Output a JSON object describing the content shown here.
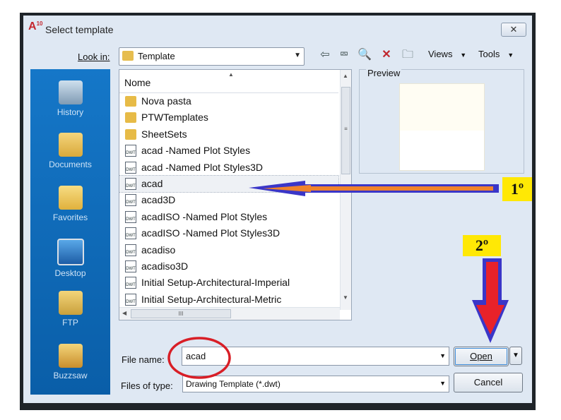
{
  "window": {
    "title": "Select template",
    "app_icon_text": "A",
    "app_icon_sub": "10",
    "close_symbol": "✕"
  },
  "toolbar": {
    "look_in_label": "Look in:",
    "look_in_value": "Template",
    "views_label": "Views",
    "tools_label": "Tools",
    "icons": [
      "back-icon",
      "up-folder-icon",
      "search-web-icon",
      "delete-icon",
      "new-folder-icon"
    ]
  },
  "places": [
    {
      "label": "History",
      "icon": "history-icon"
    },
    {
      "label": "Documents",
      "icon": "documents-icon"
    },
    {
      "label": "Favorites",
      "icon": "favorites-icon"
    },
    {
      "label": "Desktop",
      "icon": "desktop-icon"
    },
    {
      "label": "FTP",
      "icon": "ftp-icon"
    },
    {
      "label": "Buzzsaw",
      "icon": "buzzsaw-icon"
    }
  ],
  "file_list": {
    "column_header": "Nome",
    "items": [
      {
        "name": "Nova pasta",
        "type": "folder"
      },
      {
        "name": "PTWTemplates",
        "type": "folder"
      },
      {
        "name": "SheetSets",
        "type": "folder"
      },
      {
        "name": "acad -Named Plot Styles",
        "type": "dwt"
      },
      {
        "name": "acad -Named Plot Styles3D",
        "type": "dwt"
      },
      {
        "name": "acad",
        "type": "dwt",
        "selected": true
      },
      {
        "name": "acad3D",
        "type": "dwt"
      },
      {
        "name": "acadISO -Named Plot Styles",
        "type": "dwt"
      },
      {
        "name": "acadISO -Named Plot Styles3D",
        "type": "dwt"
      },
      {
        "name": "acadiso",
        "type": "dwt"
      },
      {
        "name": "acadiso3D",
        "type": "dwt"
      },
      {
        "name": "Initial Setup-Architectural-Imperial",
        "type": "dwt"
      },
      {
        "name": "Initial Setup-Architectural-Metric",
        "type": "dwt"
      }
    ],
    "dwt_icon_text": "DWT"
  },
  "preview": {
    "label": "Preview"
  },
  "form": {
    "file_name_label": "File name:",
    "file_name_value": "acad",
    "files_of_type_label": "Files of type:",
    "files_of_type_value": "Drawing Template (*.dwt)",
    "open_label": "Open",
    "cancel_label": "Cancel"
  },
  "annotations": {
    "step1": "1º",
    "step2": "2º",
    "colors": {
      "arrow_blue": "#3a36c8",
      "arrow_orange": "#f0832b",
      "arrow_red": "#e8222a",
      "circle_red": "#d81e26",
      "label_bg": "#ffe805"
    }
  }
}
